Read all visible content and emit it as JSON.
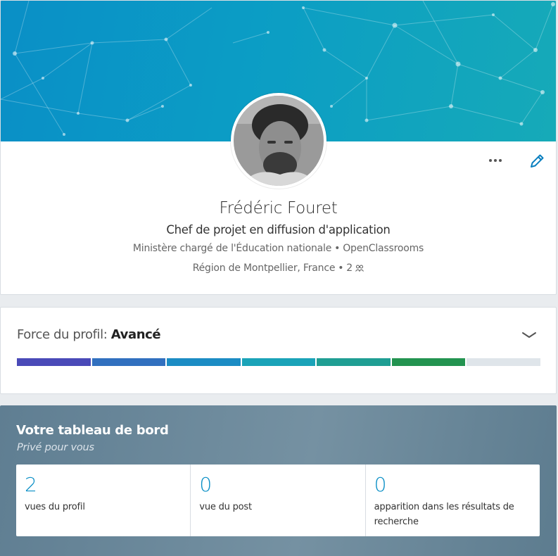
{
  "profile": {
    "name": "Frédéric Fouret",
    "headline": "Chef de projet en diffusion d'application",
    "employer": "Ministère chargé de l'Éducation nationale",
    "school": "OpenClassrooms",
    "location": "Région de Montpellier, France",
    "connections": "2",
    "separator": "•",
    "icons": {
      "more": "more-dots-icon",
      "edit": "pencil-icon",
      "connections": "people-icon"
    },
    "banner_colors": [
      "#0a8fc6",
      "#16aab8"
    ]
  },
  "strength": {
    "label": "Force du profil:",
    "level": "Avancé",
    "filled_segments": 6,
    "total_segments": 7,
    "segment_colors": [
      "#4a4ab8",
      "#3170bf",
      "#1b8cc4",
      "#1aa3b8",
      "#1f9e93",
      "#239350",
      "#dfe5ea"
    ],
    "icon": "chevron-down-icon"
  },
  "dashboard": {
    "title": "Votre tableau de bord",
    "subtitle": "Privé pour vous",
    "stats": [
      {
        "value": "2",
        "label": "vues du profil"
      },
      {
        "value": "0",
        "label": "vue du post"
      },
      {
        "value": "0",
        "label": "apparition dans les résultats de recherche"
      }
    ]
  }
}
